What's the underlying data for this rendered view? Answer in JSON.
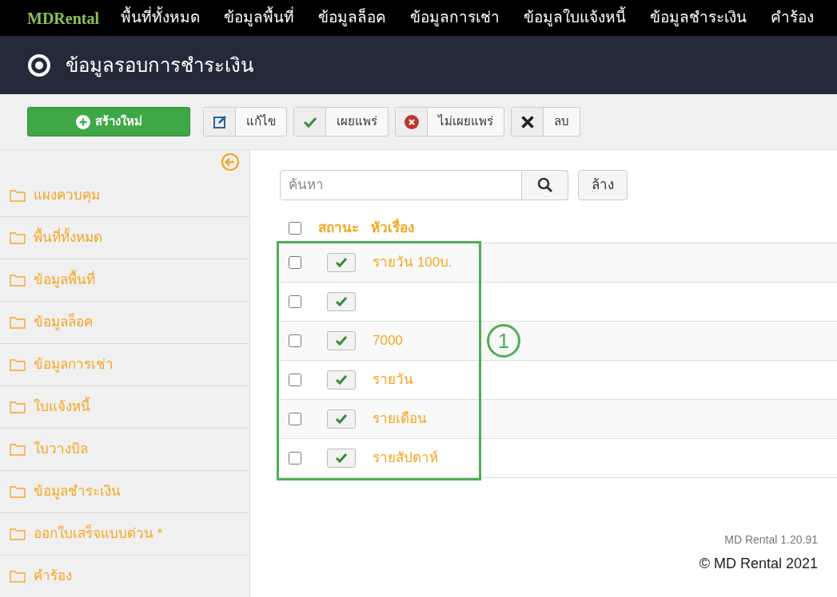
{
  "navbar": {
    "brand": "MDRental",
    "items": [
      "พื้นที่ทั้งหมด",
      "ข้อมูลพื้นที่",
      "ข้อมูลล็อค",
      "ข้อมูลการเช่า",
      "ข้อมูลใบแจ้งหนี้",
      "ข้อมูลชำระเงิน",
      "คำร้อง"
    ]
  },
  "header": {
    "title": "ข้อมูลรอบการชำระเงิน"
  },
  "toolbar": [
    {
      "kind": "new",
      "label": "สร้างใหม่"
    },
    {
      "kind": "edit",
      "label": "แก้ไข"
    },
    {
      "kind": "publish",
      "label": "เผยแพร่"
    },
    {
      "kind": "unpublish",
      "label": "ไม่เผยแพร่"
    },
    {
      "kind": "delete",
      "label": "ลบ"
    }
  ],
  "sidebar": {
    "items": [
      "แผงควบคุม",
      "พื้นที่ทั้งหมด",
      "ข้อมูลพื้นที่",
      "ข้อมูลล็อค",
      "ข้อมูลการเช่า",
      "ใบแจ้งหนี้",
      "ใบวางบิล",
      "ข้อมูลชำระเงิน",
      "ออกใบเสร็จแบบด่วน *",
      "คำร้อง"
    ]
  },
  "search": {
    "placeholder": "ค้นหา",
    "clear_label": "ล้าง"
  },
  "table": {
    "columns": [
      "สถานะ",
      "หัวเรื่อง"
    ],
    "select_all_checked": false,
    "rows": [
      {
        "checked": false,
        "published": true,
        "title": "รายวัน 100บ."
      },
      {
        "checked": false,
        "published": true
      },
      {
        "checked": false,
        "published": true,
        "title": "7000"
      },
      {
        "checked": false,
        "published": true,
        "title": "รายวัน"
      },
      {
        "checked": false,
        "published": true,
        "title": "รายเดือน"
      },
      {
        "checked": false,
        "published": true,
        "title": "รายสัปดาห์"
      }
    ]
  },
  "annotation": {
    "label": "1"
  },
  "footer": {
    "version": "MD Rental 1.20.91",
    "copyright": "© MD Rental 2021"
  }
}
